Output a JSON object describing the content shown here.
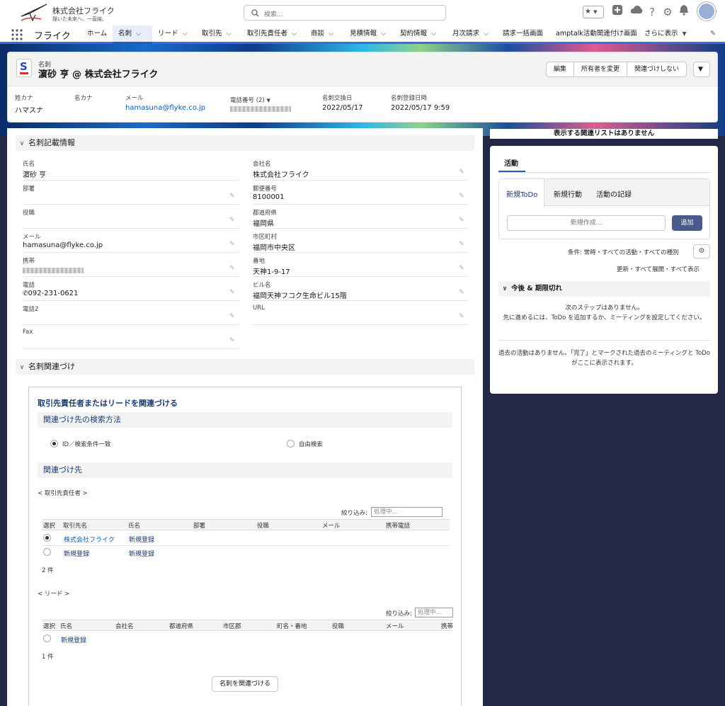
{
  "header": {
    "brand": "株式会社フライク",
    "tagline": "描いた未来へ、一直線。",
    "search_placeholder": "検索..."
  },
  "nav": {
    "app_name": "フライク",
    "items": [
      {
        "label": "ホーム",
        "chevron": false
      },
      {
        "label": "名刺",
        "chevron": true,
        "active": true
      },
      {
        "label": "リード",
        "chevron": true
      },
      {
        "label": "取引先",
        "chevron": true
      },
      {
        "label": "取引先責任者",
        "chevron": true
      },
      {
        "label": "商談",
        "chevron": true
      },
      {
        "label": "見積情報",
        "chevron": true
      },
      {
        "label": "契約情報",
        "chevron": true
      },
      {
        "label": "月次請求",
        "chevron": true
      },
      {
        "label": "請求一括画面",
        "chevron": false
      },
      {
        "label": "amptalk活動関連付け画面",
        "chevron": false
      },
      {
        "label": "さらに表示",
        "chevron": true
      }
    ]
  },
  "record": {
    "type": "名刺",
    "title": "濵砂 亨 @ 株式会社フライク",
    "actions": [
      "編集",
      "所有者を変更",
      "関連づけしない"
    ],
    "highlights": [
      {
        "label": "姓カナ",
        "value": "ハマスナ"
      },
      {
        "label": "名カナ",
        "value": ""
      },
      {
        "label": "メール",
        "value": "hamasuna@flyke.co.jp"
      },
      {
        "label": "電話番号 (2)",
        "value": ""
      },
      {
        "label": "名刺交換日",
        "value": "2022/05/17"
      },
      {
        "label": "名刺登録日時",
        "value": "2022/05/17 9:59"
      }
    ]
  },
  "details": {
    "section_title": "名刺記載情報",
    "left": [
      {
        "label": "氏名",
        "value": "濵砂 亨"
      },
      {
        "label": "部署",
        "value": ""
      },
      {
        "label": "役職",
        "value": ""
      },
      {
        "label": "メール",
        "value": "hamasuna@flyke.co.jp"
      },
      {
        "label": "携帯",
        "value": ""
      },
      {
        "label": "電話",
        "value": "092-231-0621"
      },
      {
        "label": "電話2",
        "value": ""
      },
      {
        "label": "Fax",
        "value": ""
      }
    ],
    "right": [
      {
        "label": "会社名",
        "value": "株式会社フライク"
      },
      {
        "label": "郵便番号",
        "value": "8100001"
      },
      {
        "label": "都道府県",
        "value": "福岡県"
      },
      {
        "label": "市区町村",
        "value": "福岡市中央区"
      },
      {
        "label": "番地",
        "value": "天神1-9-17"
      },
      {
        "label": "ビル名",
        "value": "福岡天神フコク生命ビル15階"
      },
      {
        "label": "URL",
        "value": ""
      }
    ]
  },
  "relation": {
    "section_title": "名刺関連づけ",
    "card_title": "取引先責任者またはリードを関連づける",
    "method_title": "関連づけ先の検索方法",
    "radio_id": "ID／検索条件一致",
    "radio_free": "自由検索",
    "target_title": "関連づけ先",
    "contacts_label": "< 取引先責任者 >",
    "filter_label": "絞り込み:",
    "filter_placeholder": "処理中...",
    "contact_columns": [
      "選択",
      "取引先名",
      "氏名",
      "部署",
      "役職",
      "メール",
      "携帯電話"
    ],
    "contact_rows": [
      {
        "account": "株式会社フライク",
        "name": "新規登録",
        "selected": true
      },
      {
        "account": "新規登録",
        "name": "新規登録",
        "selected": false
      }
    ],
    "contact_count": "2 件",
    "leads_label": "< リード >",
    "lead_columns": [
      "選択",
      "氏名",
      "会社名",
      "都道府県",
      "市区郡",
      "町名・番地",
      "役職",
      "メール",
      "携帯"
    ],
    "lead_rows": [
      {
        "name": "新規登録"
      }
    ],
    "lead_count": "1 件",
    "submit": "名刺を関連づける"
  },
  "sidebar": {
    "no_related": "表示する関連リストはありません",
    "activity_tab": "活動",
    "tabs": [
      "新規ToDo",
      "新規行動",
      "活動の記録"
    ],
    "new_placeholder": "新規作成...",
    "add_button": "追加",
    "filter_text": "条件: 常時・すべての活動・すべての種別",
    "links": "更新・すべて展開・すべて表示",
    "upcoming_title": "今後 & 期限切れ",
    "no_steps_1": "次のステップはありません。",
    "no_steps_2": "先に進めるには、ToDo を追加するか、ミーティングを設定してください。",
    "past_text": "過去の活動はありません。「完了」とマークされた過去のミーティングと ToDo がここに表示されます。"
  },
  "colors": {
    "brand": "#1b5fbf",
    "link": "#0b5cab",
    "add_button": "#4b5a8a"
  }
}
